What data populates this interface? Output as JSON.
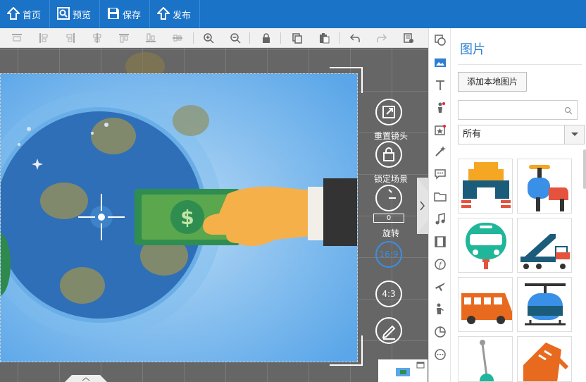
{
  "toolbar": {
    "home": "首页",
    "preview": "预览",
    "save": "保存",
    "publish": "发布"
  },
  "rail": {
    "reset_camera": "重置镜头",
    "lock_scene": "锁定场景",
    "rotate_value": "0",
    "rotate": "旋转",
    "ratio_16_9": "16:9",
    "ratio_4_3": "4:3"
  },
  "panel": {
    "title": "图片",
    "add_local": "添加本地图片",
    "search_placeholder": "",
    "filter_selected": "所有"
  },
  "colors": {
    "accent": "#1a73c6",
    "panel_title": "#2d7fd3",
    "canvas_bg": "#666666",
    "scene_blue": "#5aa6e8"
  }
}
